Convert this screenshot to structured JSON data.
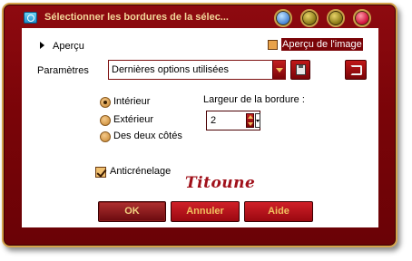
{
  "window": {
    "title": "Sélectionner les bordures de la sélec..."
  },
  "preview": {
    "label": "Aperçu",
    "image_preview_label": "Aperçu de l'image",
    "image_preview_checked": true
  },
  "params": {
    "label": "Paramètres",
    "preset_value": "Dernières options utilisées"
  },
  "options": {
    "radios": [
      {
        "label": "Intérieur",
        "checked": true
      },
      {
        "label": "Extérieur",
        "checked": false
      },
      {
        "label": "Des deux côtés",
        "checked": false
      }
    ],
    "border_width_label": "Largeur de la bordure :",
    "border_width_value": "2",
    "antialias_label": "Anticrénelage",
    "antialias_checked": true
  },
  "signature": "Titoune",
  "buttons": {
    "ok": "OK",
    "cancel": "Annuler",
    "help": "Aide"
  },
  "colors": {
    "frame": "#7a0408",
    "frame_border": "#d4a24a",
    "title_text": "#f3d79a",
    "button_text": "#f0c060"
  }
}
